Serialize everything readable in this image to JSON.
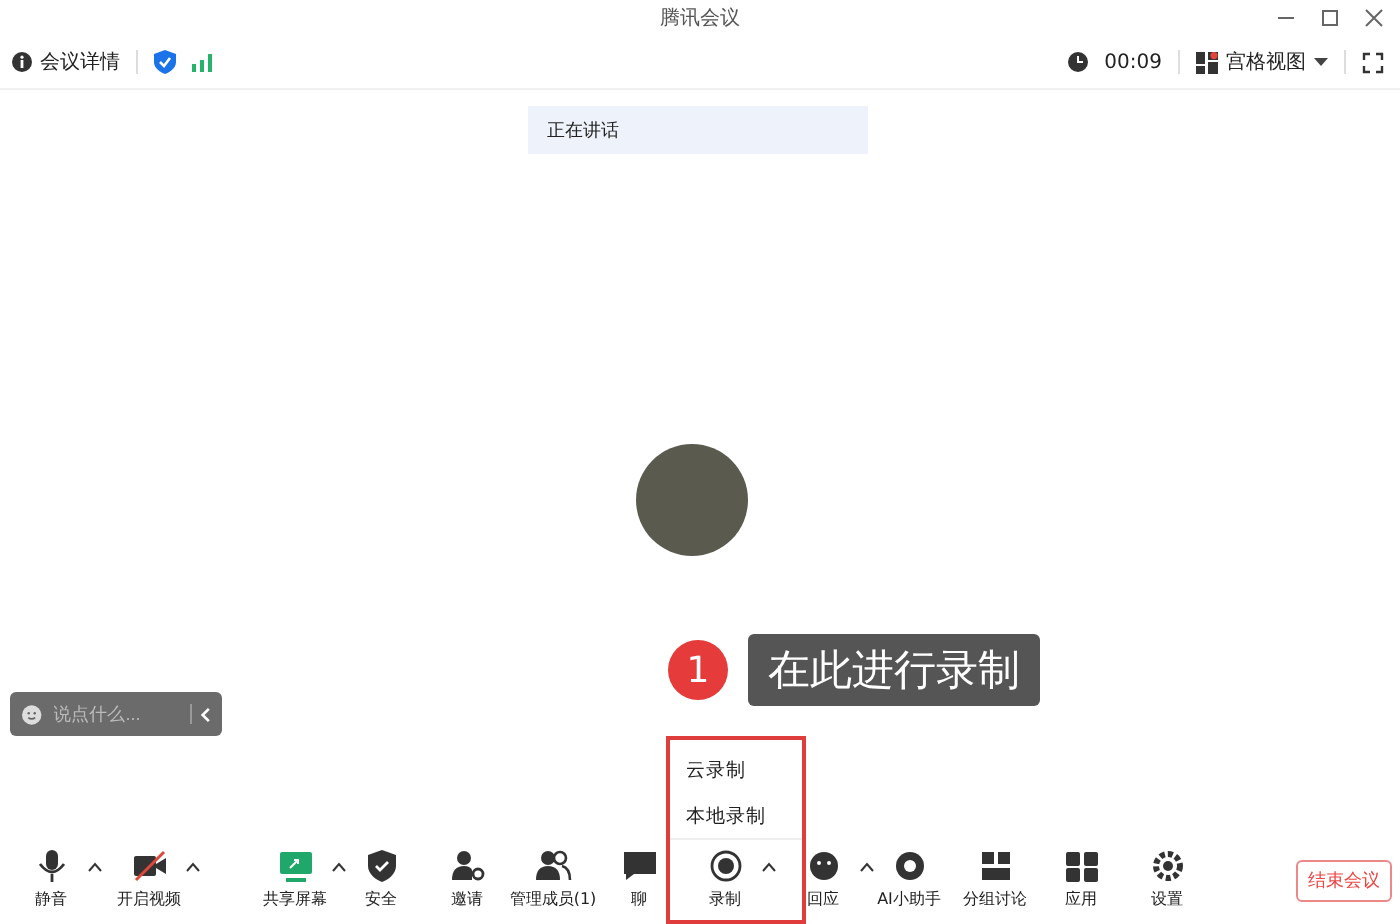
{
  "window": {
    "title": "腾讯会议"
  },
  "info_bar": {
    "details": "会议详情",
    "timer": "00:09",
    "view": "宫格视图",
    "view_notice": true
  },
  "speaking": {
    "label": "正在讲话"
  },
  "chat_input": {
    "placeholder": "说点什么..."
  },
  "callout": {
    "number": "1",
    "text": "在此进行录制"
  },
  "record_menu": {
    "items": [
      "云录制",
      "本地录制"
    ]
  },
  "toolbar": {
    "items": [
      {
        "kind": "mic",
        "label": "静音",
        "caret": true
      },
      {
        "kind": "video",
        "label": "开启视频",
        "caret": true
      },
      {
        "kind": "share",
        "label": "共享屏幕",
        "caret": true
      },
      {
        "kind": "security",
        "label": "安全",
        "caret": false
      },
      {
        "kind": "invite",
        "label": "邀请",
        "caret": false
      },
      {
        "kind": "members",
        "label": "管理成员(1)",
        "caret": false
      },
      {
        "kind": "chat",
        "label": "聊",
        "caret": false
      },
      {
        "kind": "record",
        "label": "录制",
        "caret": true
      },
      {
        "kind": "react",
        "label": "回应",
        "caret": true
      },
      {
        "kind": "ai",
        "label": "AI小助手",
        "caret": false
      },
      {
        "kind": "rooms",
        "label": "分组讨论",
        "caret": false
      },
      {
        "kind": "apps",
        "label": "应用",
        "caret": false
      },
      {
        "kind": "settings",
        "label": "设置",
        "caret": false
      }
    ],
    "end_button": "结束会议"
  }
}
